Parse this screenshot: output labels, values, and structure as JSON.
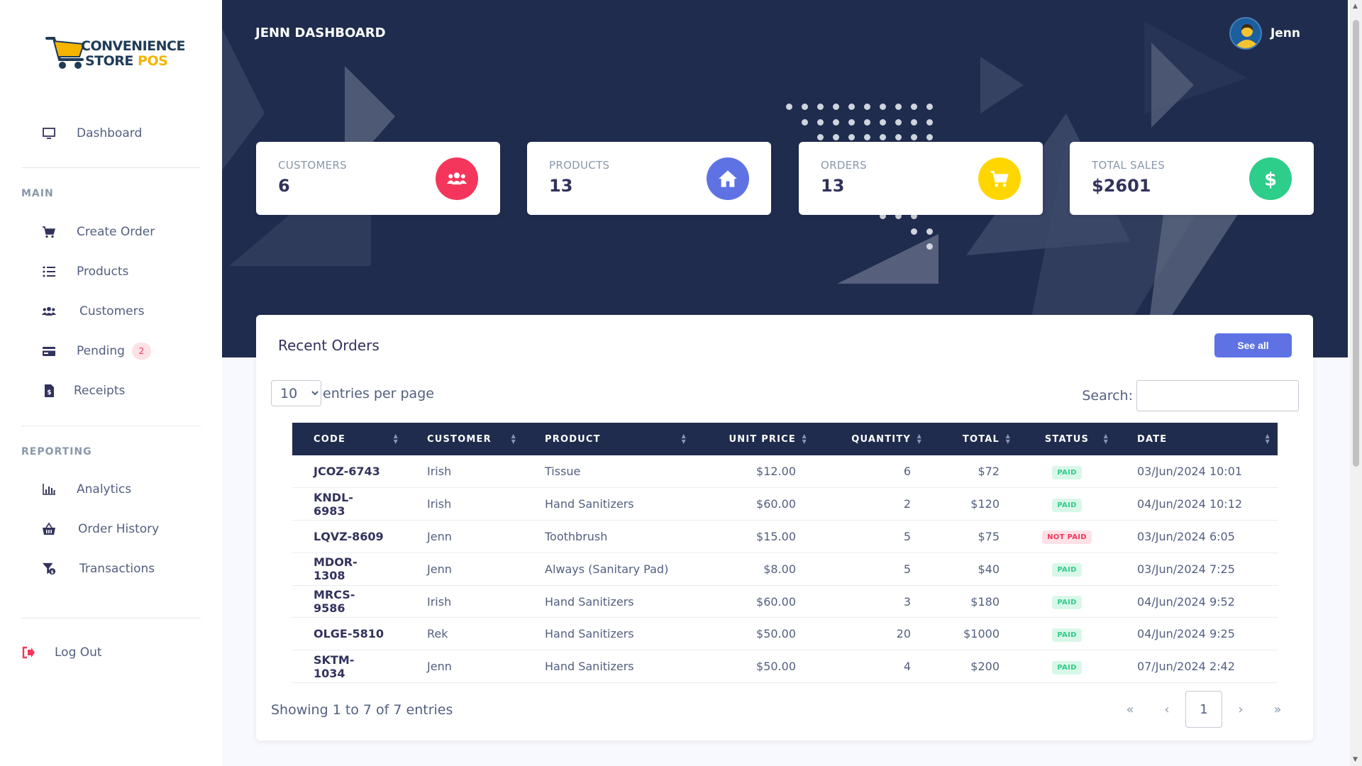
{
  "logo": {
    "line1": "CONVENIENCE",
    "line2_a": "STORE",
    "line2_b": "POS"
  },
  "sidebar": {
    "dashboard": "Dashboard",
    "main_label": "MAIN",
    "main_items": [
      {
        "label": "Create Order",
        "icon": "cart-icon"
      },
      {
        "label": "Products",
        "icon": "list-icon"
      },
      {
        "label": "Customers",
        "icon": "users-icon"
      },
      {
        "label": "Pending",
        "icon": "card-icon",
        "badge": "2"
      },
      {
        "label": "Receipts",
        "icon": "receipt-icon"
      }
    ],
    "reporting_label": "REPORTING",
    "reporting_items": [
      {
        "label": "Analytics",
        "icon": "bar-chart-icon"
      },
      {
        "label": "Order History",
        "icon": "basket-icon"
      },
      {
        "label": "Transactions",
        "icon": "funnel-dollar-icon"
      }
    ],
    "logout": "Log Out"
  },
  "header": {
    "title": "JENN DASHBOARD",
    "user_name": "Jenn"
  },
  "stats": [
    {
      "label": "CUSTOMERS",
      "value": "6",
      "color": "#f5365c",
      "icon": "users-icon"
    },
    {
      "label": "PRODUCTS",
      "value": "13",
      "color": "#5e72e4",
      "icon": "home-icon"
    },
    {
      "label": "ORDERS",
      "value": "13",
      "color": "#ffd600",
      "icon": "cart-icon"
    },
    {
      "label": "TOTAL SALES",
      "value": "$2601",
      "color": "#2dce89",
      "icon": "dollar-icon"
    }
  ],
  "orders": {
    "title": "Recent Orders",
    "see_all": "See all",
    "per_page_value": "10",
    "per_page_label": "entries per page",
    "search_label": "Search:",
    "columns": [
      "CODE",
      "CUSTOMER",
      "PRODUCT",
      "UNIT PRICE",
      "QUANTITY",
      "TOTAL",
      "STATUS",
      "DATE"
    ],
    "rows": [
      {
        "code": "JCOZ-6743",
        "customer": "Irish",
        "product": "Tissue",
        "unit_price": "$12.00",
        "quantity": "6",
        "total": "$72",
        "status": "PAID",
        "date": "03/Jun/2024 10:01"
      },
      {
        "code": "KNDL-6983",
        "customer": "Irish",
        "product": "Hand Sanitizers",
        "unit_price": "$60.00",
        "quantity": "2",
        "total": "$120",
        "status": "PAID",
        "date": "04/Jun/2024 10:12"
      },
      {
        "code": "LQVZ-8609",
        "customer": "Jenn",
        "product": "Toothbrush",
        "unit_price": "$15.00",
        "quantity": "5",
        "total": "$75",
        "status": "NOT PAID",
        "date": "03/Jun/2024 6:05"
      },
      {
        "code": "MDOR-1308",
        "customer": "Jenn",
        "product": "Always (Sanitary Pad)",
        "unit_price": "$8.00",
        "quantity": "5",
        "total": "$40",
        "status": "PAID",
        "date": "03/Jun/2024 7:25"
      },
      {
        "code": "MRCS-9586",
        "customer": "Irish",
        "product": "Hand Sanitizers",
        "unit_price": "$60.00",
        "quantity": "3",
        "total": "$180",
        "status": "PAID",
        "date": "04/Jun/2024 9:52"
      },
      {
        "code": "OLGE-5810",
        "customer": "Rek",
        "product": "Hand Sanitizers",
        "unit_price": "$50.00",
        "quantity": "20",
        "total": "$1000",
        "status": "PAID",
        "date": "04/Jun/2024 9:25"
      },
      {
        "code": "SKTM-1034",
        "customer": "Jenn",
        "product": "Hand Sanitizers",
        "unit_price": "$50.00",
        "quantity": "4",
        "total": "$200",
        "status": "PAID",
        "date": "07/Jun/2024 2:42"
      }
    ],
    "showing": "Showing 1 to 7 of 7 entries",
    "pager": {
      "first": "«",
      "prev": "‹",
      "current": "1",
      "next": "›",
      "last": "»"
    }
  }
}
